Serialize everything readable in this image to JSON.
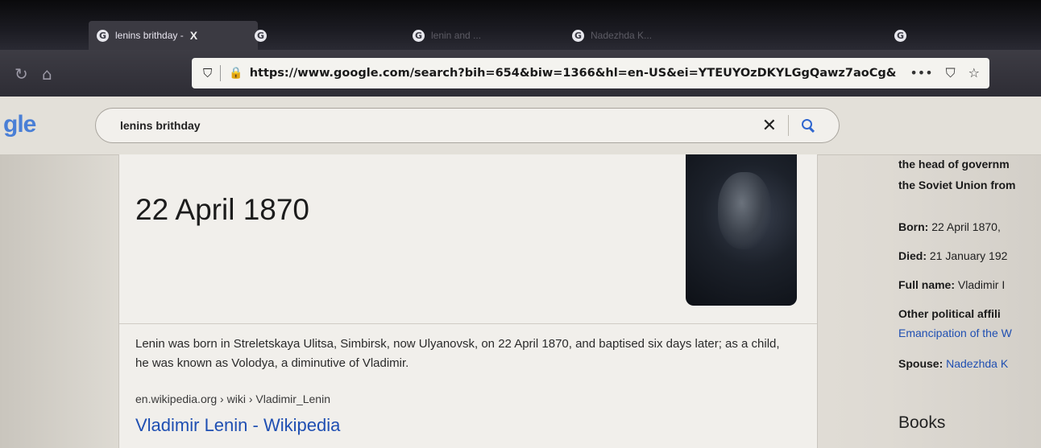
{
  "browser": {
    "tabs": [
      {
        "label": "lenins brithday - ",
        "active": true,
        "close": "X"
      },
      {
        "label": "",
        "active": false
      },
      {
        "label": "lenin and ...",
        "active": false
      },
      {
        "label": "Nadezhda K...",
        "active": false
      },
      {
        "label": "",
        "active": false
      }
    ],
    "url": "https://www.google.com/search?bih=654&biw=1366&hl=en-US&ei=YTEUYOzDKYLGgQawz7aoCg&",
    "more_icon": "•••"
  },
  "search": {
    "logo_fragment": "gle",
    "query": "lenins brithday",
    "clear_symbol": "✕"
  },
  "answer_card": {
    "answer": "22 April 1870",
    "snippet": "Lenin was born in Streletskaya Ulitsa, Simbirsk, now Ulyanovsk, on 22 April 1870, and baptised six days later; as a child, he was known as Volodya, a diminutive of Vladimir.",
    "breadcrumb": "en.wikipedia.org › wiki › Vladimir_Lenin",
    "result_title": "Vladimir Lenin - Wikipedia"
  },
  "knowledge_panel": {
    "desc_line1": "the head of governm",
    "desc_line2": "the Soviet Union from",
    "born_label": "Born:",
    "born_value": " 22 April 1870,",
    "died_label": "Died:",
    "died_value": " 21 January 192",
    "fullname_label": "Full name:",
    "fullname_value": " Vladimir I",
    "affil_label": "Other political affili",
    "affil_value": "Emancipation of the W",
    "spouse_label": "Spouse:",
    "spouse_value": " Nadezhda K",
    "books_heading": "Books"
  }
}
